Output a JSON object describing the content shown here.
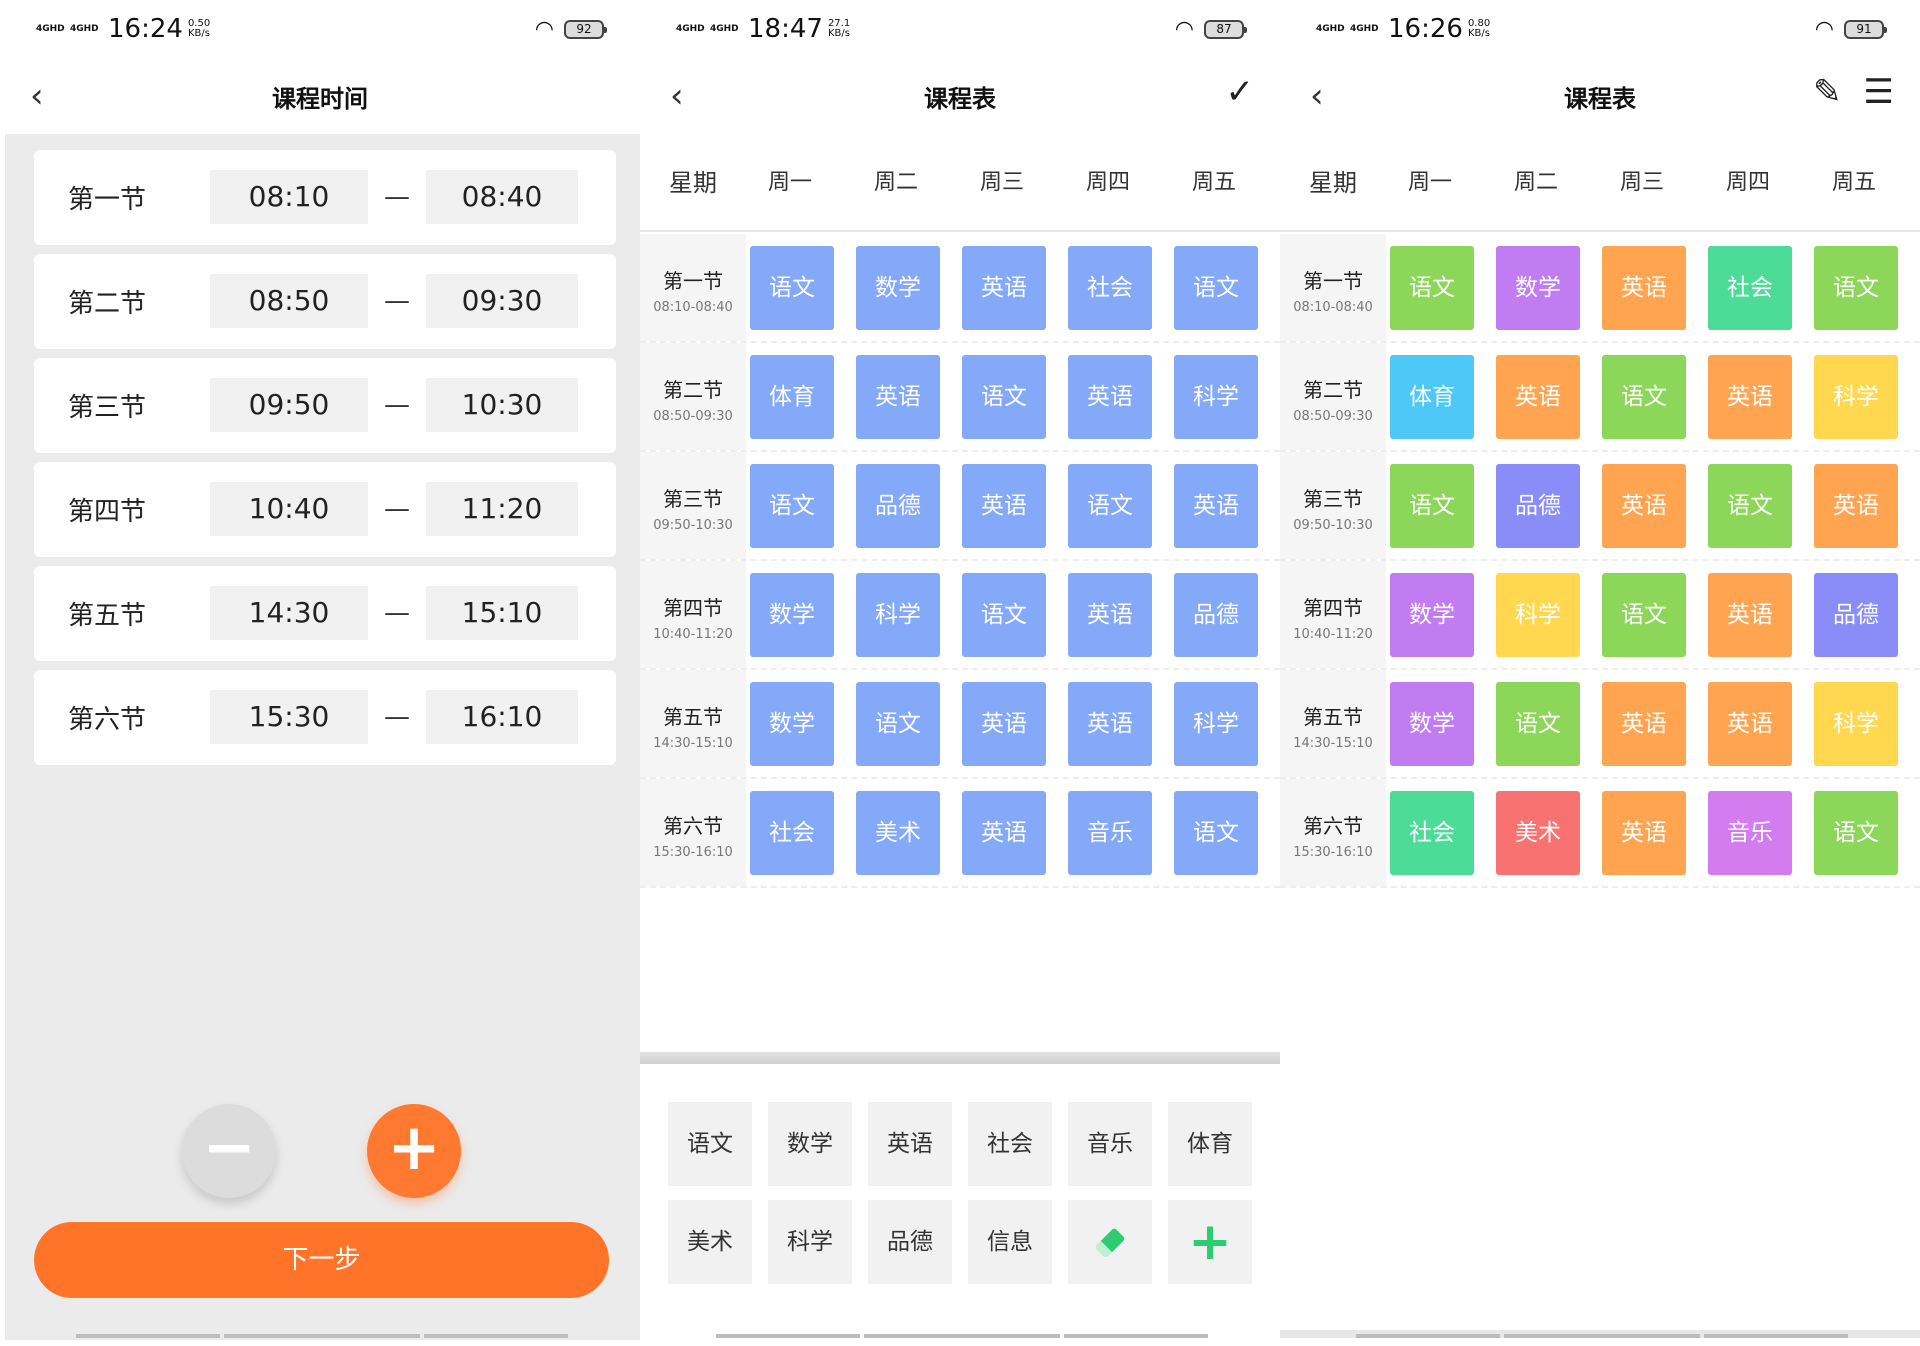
{
  "panel1": {
    "status": {
      "signal_1": "4GHD",
      "signal_2": "4GHD",
      "time": "16:24",
      "speed_value": "0.50",
      "speed_unit": "KB/s",
      "battery": "92"
    },
    "nav": {
      "title": "课程时间"
    },
    "slots": [
      {
        "name": "第一节",
        "start": "08:10",
        "end": "08:40"
      },
      {
        "name": "第二节",
        "start": "08:50",
        "end": "09:30"
      },
      {
        "name": "第三节",
        "start": "09:50",
        "end": "10:30"
      },
      {
        "name": "第四节",
        "start": "10:40",
        "end": "11:20"
      },
      {
        "name": "第五节",
        "start": "14:30",
        "end": "15:10"
      },
      {
        "name": "第六节",
        "start": "15:30",
        "end": "16:10"
      }
    ],
    "separator": "—",
    "minus_icon": "minus-icon",
    "plus_icon": "plus-icon",
    "next_label": "下一步",
    "accent": "#ff7428"
  },
  "panel2": {
    "status": {
      "signal_1": "4GHD",
      "signal_2": "4GHD",
      "time": "18:47",
      "speed_value": "27.1",
      "speed_unit": "KB/s",
      "battery": "87"
    },
    "nav": {
      "title": "课程表",
      "confirm_icon": "check-icon"
    },
    "cell_color": "#83a9f8",
    "picker": {
      "row1": [
        "语文",
        "数学",
        "英语",
        "社会",
        "音乐",
        "体育"
      ],
      "row2": [
        "美术",
        "科学",
        "品德",
        "信息"
      ],
      "eraser_icon": "eraser-icon",
      "add_icon": "plus-icon"
    }
  },
  "panel3": {
    "status": {
      "signal_1": "4GHD",
      "signal_2": "4GHD",
      "time": "16:26",
      "speed_value": "0.80",
      "speed_unit": "KB/s",
      "battery": "91"
    },
    "nav": {
      "title": "课程表",
      "edit_icon": "pencil-icon",
      "settings_icon": "sliders-icon"
    },
    "subject_colors": {
      "语文": "#8cd65a",
      "数学": "#c07cf0",
      "英语": "#ffa552",
      "社会": "#4ddc97",
      "体育": "#4dc8f7",
      "科学": "#ffd84f",
      "品德": "#8a8df7",
      "美术": "#f97272",
      "音乐": "#d37cf0"
    }
  },
  "timetable": {
    "header_first": "星期",
    "days": [
      "周一",
      "周二",
      "周三",
      "周四",
      "周五"
    ],
    "rows": [
      {
        "name": "第一节",
        "time": "08:10-08:40",
        "subjects": [
          "语文",
          "数学",
          "英语",
          "社会",
          "语文"
        ]
      },
      {
        "name": "第二节",
        "time": "08:50-09:30",
        "subjects": [
          "体育",
          "英语",
          "语文",
          "英语",
          "科学"
        ]
      },
      {
        "name": "第三节",
        "time": "09:50-10:30",
        "subjects": [
          "语文",
          "品德",
          "英语",
          "语文",
          "英语"
        ]
      },
      {
        "name": "第四节",
        "time": "10:40-11:20",
        "subjects": [
          "数学",
          "科学",
          "语文",
          "英语",
          "品德"
        ]
      },
      {
        "name": "第五节",
        "time": "14:30-15:10",
        "subjects": [
          "数学",
          "语文",
          "英语",
          "英语",
          "科学"
        ]
      },
      {
        "name": "第六节",
        "time": "15:30-16:10",
        "subjects": [
          "社会",
          "美术",
          "英语",
          "音乐",
          "语文"
        ]
      }
    ]
  }
}
